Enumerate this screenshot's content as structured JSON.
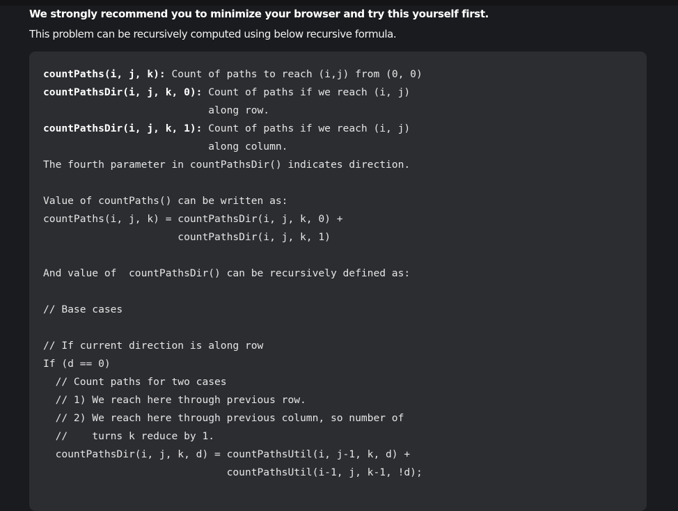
{
  "article": {
    "heading": "We strongly recommend you to minimize your browser and try this yourself first.",
    "intro": "This problem can be recursively computed using below recursive formula."
  },
  "code_lines": [
    {
      "bold": "countPaths(i, j, k):",
      "rest": " Count of paths to reach (i,j) from (0, 0)"
    },
    {
      "bold": "countPathsDir(i, j, k, 0):",
      "rest": " Count of paths if we reach (i, j)"
    },
    {
      "bold": "",
      "rest": "                           along row."
    },
    {
      "bold": "countPathsDir(i, j, k, 1):",
      "rest": " Count of paths if we reach (i, j)"
    },
    {
      "bold": "",
      "rest": "                           along column."
    },
    {
      "bold": "",
      "rest": "The fourth parameter in countPathsDir() indicates direction."
    },
    {
      "bold": "",
      "rest": ""
    },
    {
      "bold": "",
      "rest": "Value of countPaths() can be written as:"
    },
    {
      "bold": "",
      "rest": "countPaths(i, j, k) = countPathsDir(i, j, k, 0) +"
    },
    {
      "bold": "",
      "rest": "                      countPathsDir(i, j, k, 1)"
    },
    {
      "bold": "",
      "rest": ""
    },
    {
      "bold": "",
      "rest": "And value of  countPathsDir() can be recursively defined as:"
    },
    {
      "bold": "",
      "rest": ""
    },
    {
      "bold": "",
      "rest": "// Base cases"
    },
    {
      "bold": "",
      "rest": ""
    },
    {
      "bold": "",
      "rest": "// If current direction is along row"
    },
    {
      "bold": "",
      "rest": "If (d == 0)"
    },
    {
      "bold": "",
      "rest": "  // Count paths for two cases"
    },
    {
      "bold": "",
      "rest": "  // 1) We reach here through previous row."
    },
    {
      "bold": "",
      "rest": "  // 2) We reach here through previous column, so number of"
    },
    {
      "bold": "",
      "rest": "  //    turns k reduce by 1."
    },
    {
      "bold": "",
      "rest": "  countPathsDir(i, j, k, d) = countPathsUtil(i, j-1, k, d) +"
    },
    {
      "bold": "",
      "rest": "                              countPathsUtil(i-1, j, k-1, !d);"
    }
  ]
}
